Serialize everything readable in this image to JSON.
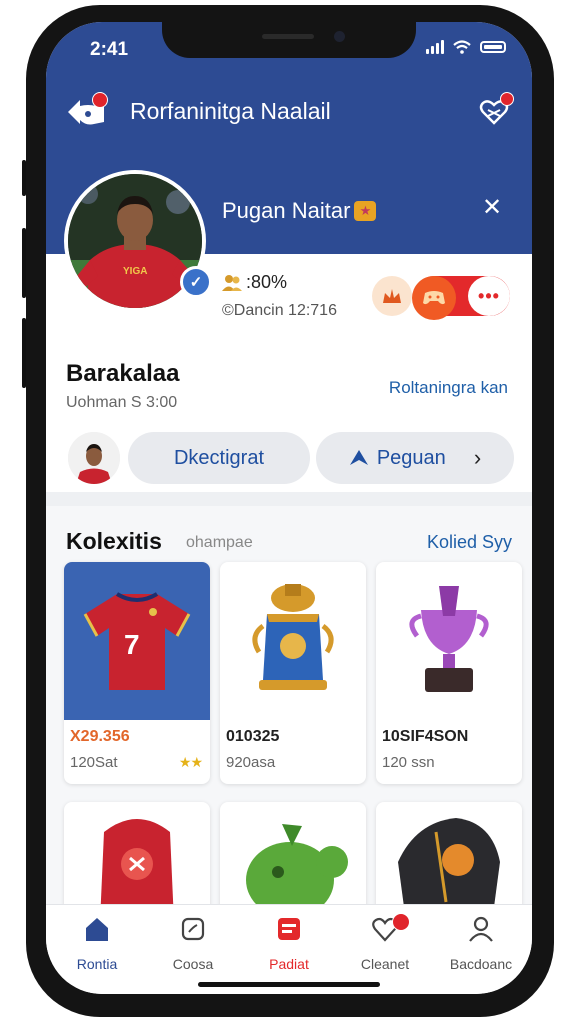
{
  "status": {
    "time": "2:41"
  },
  "nav": {
    "title": "Rorfaninitga Naalail"
  },
  "profile": {
    "name": "Pugan Naitar",
    "stat_percent": ":80%",
    "time_text": "©Dancin 12:716",
    "team_name": "Barakalaa",
    "team_sub": "Uohman S 3:00",
    "side_link": "Roltaningra kan",
    "button_left": "Dkectigrat",
    "button_right": "Peguan"
  },
  "collection": {
    "title": "Kolexitis",
    "subtitle": "ohampae",
    "link": "Kolied Syy",
    "items": [
      {
        "price": "X29.356",
        "sub": "120Sat",
        "stars": "★★"
      },
      {
        "price": "010325",
        "sub": "920asa"
      },
      {
        "price": "10SIF4SON",
        "sub": "120 ssn"
      }
    ]
  },
  "tabs": [
    {
      "label": "Rontia"
    },
    {
      "label": "Coosa"
    },
    {
      "label": "Padiat"
    },
    {
      "label": "Cleanet"
    },
    {
      "label": "Bacdoanc"
    }
  ],
  "colors": {
    "primary": "#2d4b93",
    "accent_red": "#e3292b",
    "link_blue": "#1f5fa8",
    "jersey_red": "#c8232f"
  },
  "icons": [
    "back-icon",
    "heart-icon",
    "close-icon",
    "verified-icon",
    "people-icon",
    "send-icon",
    "chevron-right-icon",
    "home-icon",
    "square-icon",
    "id-card-icon",
    "heart-badge-icon",
    "person-icon"
  ]
}
